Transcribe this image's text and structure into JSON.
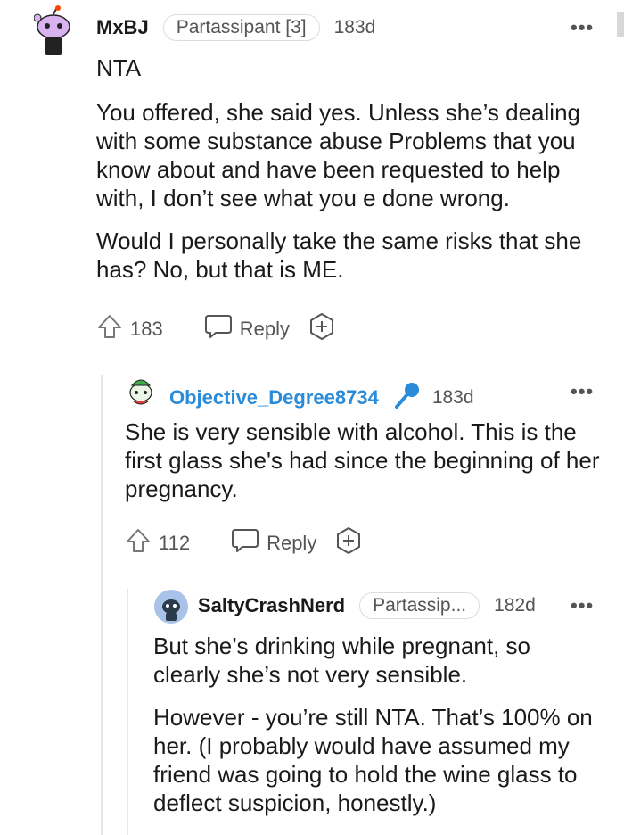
{
  "comments": [
    {
      "username": "MxBJ",
      "flair": "Partassipant [3]",
      "age": "183d",
      "paragraphs": [
        "NTA",
        "You offered, she said yes. Unless she’s dealing with some substance abuse Problems that you know about and have been requested to help with, I don’t see what you e done wrong.",
        "Would I personally take the same risks that she has? No, but that is ME."
      ],
      "votes": "183",
      "reply_label": "Reply",
      "more": "•••"
    },
    {
      "username": "Objective_Degree8734",
      "age": "183d",
      "paragraphs": [
        "She is very sensible with alcohol. This is the first glass she's had since the beginning of her pregnancy."
      ],
      "votes": "112",
      "reply_label": "Reply",
      "more": "•••"
    },
    {
      "username": "SaltyCrashNerd",
      "flair": "Partassip...",
      "age": "182d",
      "paragraphs": [
        "But she’s drinking while pregnant, so clearly she’s not very sensible.",
        "However - you’re still NTA. That’s 100% on her. (I probably would have assumed my friend was going to hold the wine glass to deflect suspicion, honestly.)"
      ],
      "more": "•••"
    }
  ],
  "icons": {
    "upvote": "upvote-arrow-icon",
    "reply": "speech-bubble-icon",
    "award": "plus-award-icon",
    "op": "microphone-icon"
  },
  "colors": {
    "op_username": "#2a8bd8",
    "text": "#1a1a1b",
    "meta": "#555555"
  }
}
